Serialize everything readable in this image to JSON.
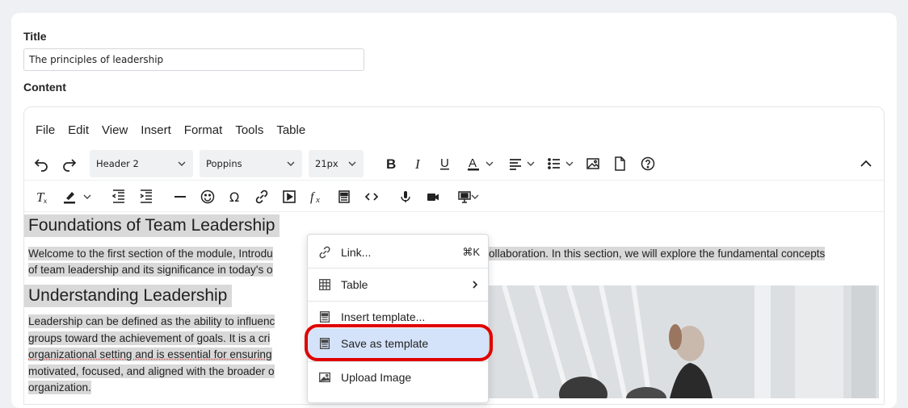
{
  "form": {
    "title_label": "Title",
    "title_value": "The principles of leadership",
    "content_label": "Content"
  },
  "menubar": [
    "File",
    "Edit",
    "View",
    "Insert",
    "Format",
    "Tools",
    "Table"
  ],
  "toolbar": {
    "block_format": "Header 2",
    "font_family": "Poppins",
    "font_size": "21px"
  },
  "content": {
    "heading1": "Foundations of Team Leadership",
    "para1_line1": "Welcome to the first section of the module, Introdu",
    "para1_line1_end": "ollaboration. In this section, we will explore the fundamental concepts",
    "para1_line2": "of team leadership and its significance in today's o",
    "heading2": "Understanding Leadership",
    "para2_line1": "Leadership can be defined as the ability to influenc",
    "para2_line2": "groups toward the achievement of goals. It is a cri",
    "para2_line3": "organizational setting and is essential for ensuring",
    "para2_line4": "motivated, focused, and aligned with the broader o",
    "para2_line5": "organization."
  },
  "context_menu": {
    "items": [
      {
        "label": "Link...",
        "shortcut": "⌘K",
        "icon": "link-icon"
      },
      {
        "label": "Table",
        "icon": "table-icon",
        "submenu": true
      },
      {
        "label": "Insert template...",
        "icon": "template-icon"
      },
      {
        "label": "Save as template",
        "icon": "template-icon",
        "active": true
      },
      {
        "label": "Upload Image",
        "icon": "image-icon"
      }
    ]
  },
  "colors": {
    "accent_highlight": "#d4e3f9",
    "ring": "#e00000",
    "selection": "#d9d9d9"
  }
}
